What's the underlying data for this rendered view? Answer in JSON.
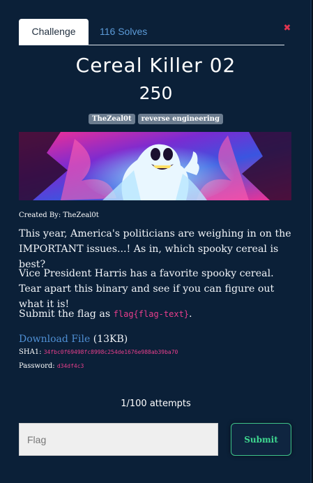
{
  "tabs": {
    "challenge": "Challenge",
    "solves": "116 Solves"
  },
  "close_glyph": "✖",
  "challenge": {
    "name": "Cereal Killer 02",
    "points": "250",
    "tags": [
      "TheZeal0t",
      "reverse engineering"
    ],
    "banner_icon": "ghost-banner-image",
    "created_by": "Created By: TheZeal0t",
    "description": {
      "p1": "This year, America's politicians are weighing in on the IMPORTANT issues...! As in, which spooky cereal is best?",
      "p2": "Vice President Harris has a favorite spooky cereal. Tear apart this binary and see if you can figure out what it is!",
      "p3_prefix": "Submit the flag as ",
      "p3_code": "flag{flag-text}",
      "p3_suffix": "."
    },
    "file": {
      "link_text": "Download File",
      "size": " (13KB)",
      "sha1_label": "SHA1: ",
      "sha1_value": "34fbc0f69498fc8998c254de1676e988ab39ba70",
      "password_label": "Password: ",
      "password_value": "d34df4c3"
    },
    "attempts": "1/100 attempts",
    "flag_placeholder": "Flag",
    "submit_label": "Submit"
  },
  "colors": {
    "accent": "#3fd890",
    "link": "#4f8fd4",
    "code": "#e83e8c",
    "close": "#e0344f"
  }
}
